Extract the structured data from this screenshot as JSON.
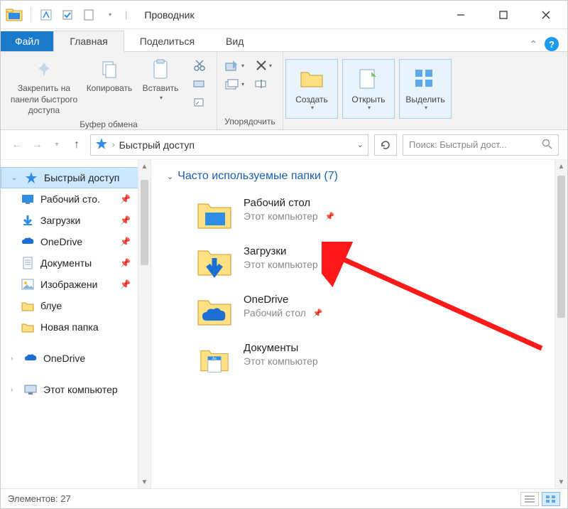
{
  "titlebar": {
    "title": "Проводник"
  },
  "tabs": {
    "file": "Файл",
    "home": "Главная",
    "share": "Поделиться",
    "view": "Вид"
  },
  "ribbon": {
    "pin_label": "Закрепить на панели быстрого доступа",
    "copy_label": "Копировать",
    "paste_label": "Вставить",
    "clipboard_group": "Буфер обмена",
    "organize_group": "Упорядочить",
    "new_label": "Создать",
    "open_label": "Открыть",
    "select_label": "Выделить"
  },
  "nav": {
    "crumb1": "Быстрый доступ",
    "search_placeholder": "Поиск: Быстрый дост..."
  },
  "sidebar": {
    "quick_access": "Быстрый доступ",
    "items": [
      {
        "label": "Рабочий сто.",
        "icon": "desktop",
        "pinned": true
      },
      {
        "label": "Загрузки",
        "icon": "downloads",
        "pinned": true
      },
      {
        "label": "OneDrive",
        "icon": "onedrive",
        "pinned": true
      },
      {
        "label": "Документы",
        "icon": "documents",
        "pinned": true
      },
      {
        "label": "Изображени",
        "icon": "pictures",
        "pinned": true
      },
      {
        "label": "блуе",
        "icon": "folder",
        "pinned": false
      },
      {
        "label": "Новая папка",
        "icon": "folder",
        "pinned": false
      }
    ],
    "onedrive": "OneDrive",
    "this_pc": "Этот компьютер"
  },
  "content": {
    "group_header": "Часто используемые папки (7)",
    "items": [
      {
        "name": "Рабочий стол",
        "sub": "Этот компьютер",
        "icon": "desktop-folder"
      },
      {
        "name": "Загрузки",
        "sub": "Этот компьютер",
        "icon": "downloads-folder"
      },
      {
        "name": "OneDrive",
        "sub": "Рабочий стол",
        "icon": "onedrive-folder"
      },
      {
        "name": "Документы",
        "sub": "Этот компьютер",
        "icon": "documents-folder"
      }
    ]
  },
  "status": {
    "elements_label": "Элементов:",
    "elements_count": "27"
  }
}
